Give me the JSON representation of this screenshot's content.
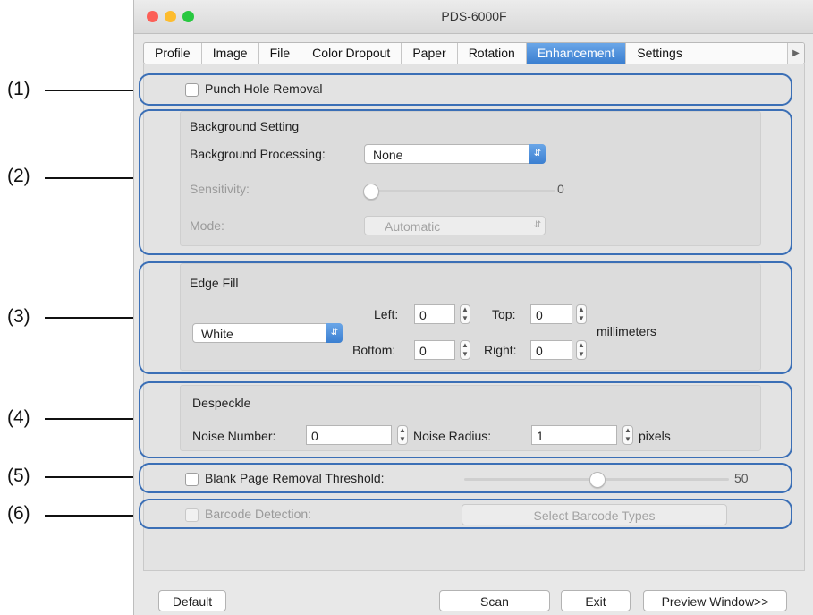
{
  "window": {
    "title": "PDS-6000F",
    "traffic_lights": {
      "close": "#fc5f57",
      "minimize": "#fdbc2e",
      "zoom": "#28c840"
    }
  },
  "tabs": [
    "Profile",
    "Image",
    "File",
    "Color Dropout",
    "Paper",
    "Rotation",
    "Enhancement",
    "Settings"
  ],
  "active_tab": "Enhancement",
  "callouts": [
    "(1)",
    "(2)",
    "(3)",
    "(4)",
    "(5)",
    "(6)"
  ],
  "punch_hole": {
    "label": "Punch Hole Removal",
    "checked": false
  },
  "background": {
    "header": "Background Setting",
    "processing_label": "Background Processing:",
    "processing_value": "None",
    "sensitivity_label": "Sensitivity:",
    "sensitivity_value": "0",
    "mode_label": "Mode:",
    "mode_value": "Automatic"
  },
  "edge_fill": {
    "header": "Edge Fill",
    "fill_value": "White",
    "left_label": "Left:",
    "left_value": "0",
    "top_label": "Top:",
    "top_value": "0",
    "bottom_label": "Bottom:",
    "bottom_value": "0",
    "right_label": "Right:",
    "right_value": "0",
    "unit": "millimeters"
  },
  "despeckle": {
    "header": "Despeckle",
    "noise_number_label": "Noise Number:",
    "noise_number_value": "0",
    "noise_radius_label": "Noise Radius:",
    "noise_radius_value": "1",
    "unit": "pixels"
  },
  "blank_page": {
    "label": "Blank Page Removal Threshold:",
    "value": "50",
    "checked": false,
    "fraction": 0.5
  },
  "barcode": {
    "label": "Barcode Detection:",
    "button": "Select Barcode Types",
    "checked": false
  },
  "footer": {
    "default": "Default",
    "scan": "Scan",
    "exit": "Exit",
    "preview": "Preview Window>>"
  },
  "colors": {
    "accent": "#3b7fd1",
    "highlight_border": "#3b6fb6"
  }
}
